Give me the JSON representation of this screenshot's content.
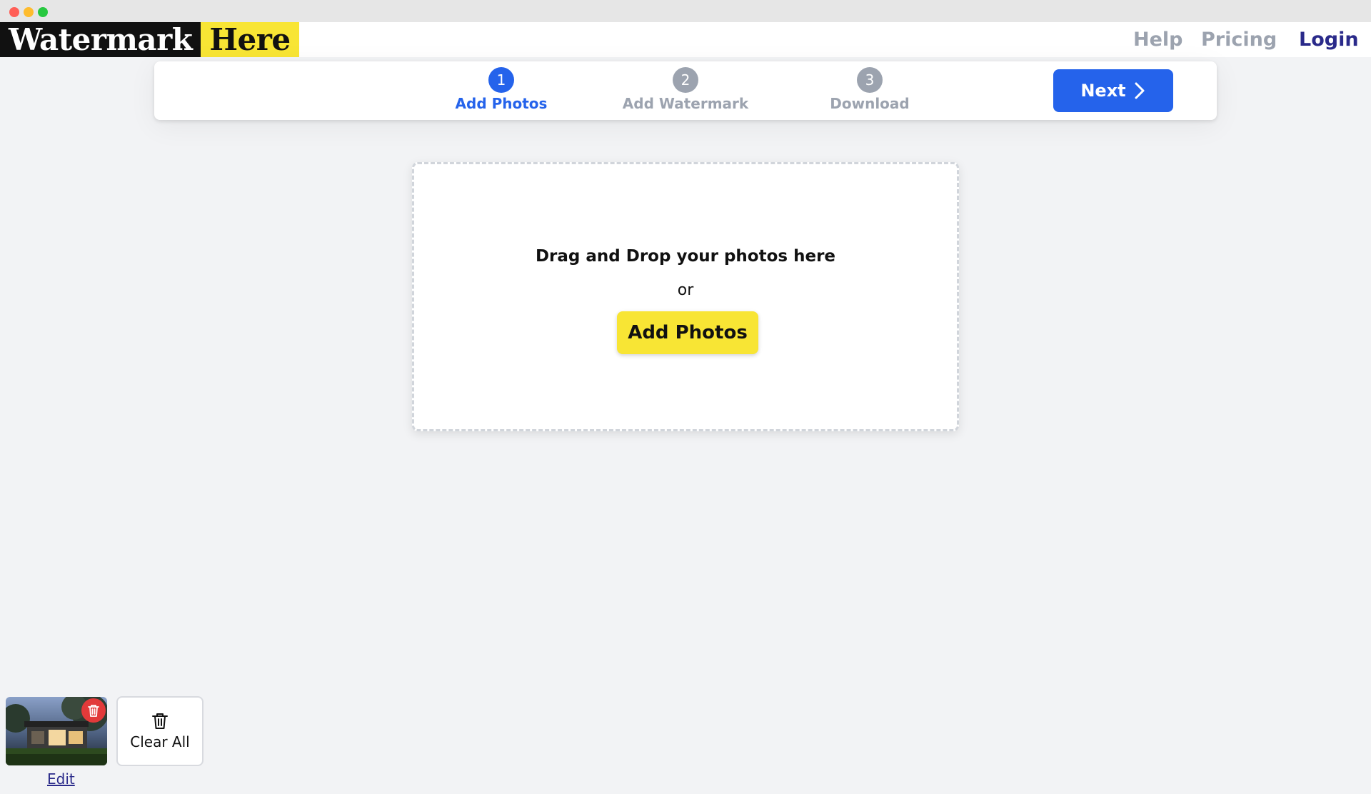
{
  "header": {
    "logo_part1": "Watermark",
    "logo_part2": "Here",
    "nav": {
      "help": "Help",
      "pricing": "Pricing",
      "login": "Login"
    }
  },
  "steps": [
    {
      "number": "1",
      "label": "Add Photos",
      "active": true
    },
    {
      "number": "2",
      "label": "Add Watermark",
      "active": false
    },
    {
      "number": "3",
      "label": "Download",
      "active": false
    }
  ],
  "next_button": {
    "label": "Next",
    "icon": "chevron-right-icon"
  },
  "dropzone": {
    "title": "Drag and Drop your photos here",
    "or_text": "or",
    "button_label": "Add Photos"
  },
  "photos": {
    "edit_label": "Edit",
    "clear_all_label": "Clear All",
    "delete_icon": "trash-icon"
  },
  "colors": {
    "accent": "#2563eb",
    "brand_yellow": "#f8e534",
    "nav_muted": "#9ca3af",
    "login": "#2a2a8a",
    "delete": "#e23a3a"
  }
}
